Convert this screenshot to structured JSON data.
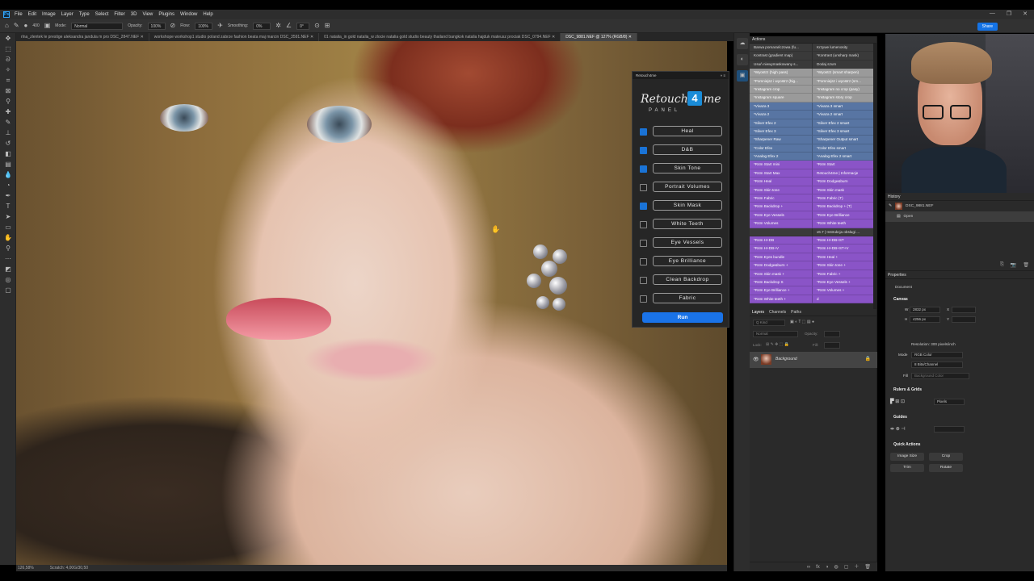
{
  "menubar": {
    "logo": "Ps",
    "items": [
      "File",
      "Edit",
      "Image",
      "Layer",
      "Type",
      "Select",
      "Filter",
      "3D",
      "View",
      "Plugins",
      "Window",
      "Help"
    ],
    "window_controls": [
      "—",
      "❐",
      "✕"
    ]
  },
  "options": {
    "brush_size": "400",
    "mode_label": "Mode:",
    "mode_value": "Normal",
    "opacity_label": "Opacity:",
    "opacity_value": "100%",
    "flow_label": "Flow:",
    "flow_value": "100%",
    "smoothing_label": "Smoothing:",
    "smoothing_value": "0%",
    "angle_value": "0°",
    "share_label": "Share"
  },
  "tabs": [
    {
      "label": "rlna_zlentek le prestige aleksandra jandula m pro DSC_2847.NEF ✕",
      "active": false
    },
    {
      "label": "workshope workshop1 studio poland zabrze fashion beata maj marcin DSC_3591.NEF ✕",
      "active": false
    },
    {
      "label": "01 natalia_in gold natalia_w zlocie natalia gold studio beauty thailand bangkok natalia hajduk mateusz prociak DSC_0794.NEF ✕",
      "active": false
    },
    {
      "label": "DSC_9881.NEF @ 127% (RGB/8) ✕",
      "active": true
    }
  ],
  "status": {
    "zoom": "126,58%",
    "scratch": "Scratch: 4,00G/30,50"
  },
  "retouch_panel": {
    "header": "Retouch4me",
    "header_controls": "»  ≡",
    "logo_left": "Retouch",
    "logo_mid": "4",
    "logo_right": "me",
    "logo_sub": "PANEL",
    "items": [
      {
        "label": "Heal",
        "checked": true
      },
      {
        "label": "D&B",
        "checked": true
      },
      {
        "label": "Skin Tone",
        "checked": true
      },
      {
        "label": "Portrait Volumes",
        "checked": false
      },
      {
        "label": "Skin Mask",
        "checked": true
      },
      {
        "label": "White Teeth",
        "checked": false
      },
      {
        "label": "Eye Vessels",
        "checked": false
      },
      {
        "label": "Eye Brilliance",
        "checked": false
      },
      {
        "label": "Clean Backdrop",
        "checked": false
      },
      {
        "label": "Fabric",
        "checked": false
      }
    ],
    "run_label": "Run"
  },
  "actions_panel": {
    "title": "Actions",
    "rows": [
      {
        "a": "Barwa pomarańczowa (fu...",
        "b": "Krzywe lumenosity",
        "g": "g0"
      },
      {
        "a": "Kontrast (gradient map)",
        "b": "*Kontrast (unsharp mask)",
        "g": "g0"
      },
      {
        "a": "Usuń niewymaskowany s...",
        "b": "Dodaj szum",
        "g": "g0"
      },
      {
        "a": "*Wyostrz (high pass)",
        "b": "*Wyostrz (smart sharpen)",
        "g": "g1"
      },
      {
        "a": "*Pomniejsz i wyostrz (hig...",
        "b": "*Pomniejsz i wyostrz (sm...",
        "g": "g1"
      },
      {
        "a": "*Instagram crop",
        "b": "*Instagram no crop (pasy)",
        "g": "g1"
      },
      {
        "a": "*Instagram square",
        "b": "*Instagram story crop",
        "g": "g1"
      },
      {
        "a": "*Vivaza 3",
        "b": "*Vivaza 3 smart",
        "g": "g2"
      },
      {
        "a": "*Vivaza 2",
        "b": "*Vivaza 2 smart",
        "g": "g2"
      },
      {
        "a": "*Silver Efex 2",
        "b": "*Silver Efex 2 smart",
        "g": "g2"
      },
      {
        "a": "*Silver Efex 3",
        "b": "*Silver Efex 3 smart",
        "g": "g2"
      },
      {
        "a": "*Sharpener Raw",
        "b": "*Sharpener Output smart",
        "g": "g2"
      },
      {
        "a": "*Color Efex",
        "b": "*Color Efex smart",
        "g": "g2"
      },
      {
        "a": "*Analog Efex 2",
        "b": "*Analog Efex 2 smart",
        "g": "g2"
      },
      {
        "a": "*R4m Start mini",
        "b": "*R4m Start",
        "g": "g3"
      },
      {
        "a": "*R4m Start Max",
        "b": "Retouch4me | Informacje",
        "g": "g3"
      },
      {
        "a": "*R4m Heal",
        "b": "*R4m Dodge&burn",
        "g": "g3"
      },
      {
        "a": "*R4m Skin tone",
        "b": "*R4m Skin mask",
        "g": "g3"
      },
      {
        "a": "*R4m Fabric",
        "b": "*R4m Fabric (T)",
        "g": "g3"
      },
      {
        "a": "*R4m Backdrop +",
        "b": "*R4m Backdrop + (T)",
        "g": "g3"
      },
      {
        "a": "*R4m Eye Vessels",
        "b": "*R4m Eye Brilliance",
        "g": "g3"
      },
      {
        "a": "*R4m Volumes",
        "b": "*R4m White teeth",
        "g": "g3"
      },
      {
        "a": "",
        "b": "v6.7 | Instrukcja obsługi ...",
        "g": "g0"
      },
      {
        "a": "*R4m H+DB",
        "b": "*R4m H+DB+ST",
        "g": "g3"
      },
      {
        "a": "*R4m H+DB+V",
        "b": "*R4m H+DB+ST+V",
        "g": "g3"
      },
      {
        "a": "*R4m Eyes bundle",
        "b": "*R4m Heal +",
        "g": "g3"
      },
      {
        "a": "*R4m Dodge&burn +",
        "b": "*R4m Skin tone +",
        "g": "g3"
      },
      {
        "a": "*R4m Skin mask +",
        "b": "*R4m Fabric +",
        "g": "g3"
      },
      {
        "a": "*R4m Backdrop S",
        "b": "*R4m Eye Vessels +",
        "g": "g3"
      },
      {
        "a": "*R4m Eye Brilliance +",
        "b": "*R4m Volumes +",
        "g": "g3"
      },
      {
        "a": "*R4m White teeth +",
        "b": "d",
        "g": "g3"
      }
    ]
  },
  "layers_panel": {
    "tabs": [
      "Layers",
      "Channels",
      "Paths"
    ],
    "kind_placeholder": "Q Kind",
    "blend": "Normal",
    "opacity_label": "Opacity:",
    "lock_label": "Lock:",
    "fill_label": "Fill:",
    "layer_name": "Background",
    "footer_icons": [
      "∞",
      "fx",
      "◑",
      "◍",
      "▢",
      "＋",
      "🗑"
    ]
  },
  "history_panel": {
    "title": "History",
    "doc": "DSC_9881.NEF",
    "step": "Open"
  },
  "properties_panel": {
    "title": "Properties",
    "document_label": "Document",
    "canvas_label": "Canvas",
    "w_label": "W",
    "w_value": "2832 px",
    "h_label": "H",
    "h_value": "4256 px",
    "x_label": "X",
    "y_label": "Y",
    "resolution": "Resolution: 300 pixels/inch",
    "mode_label": "Mode",
    "mode_value": "RGB Color",
    "bits_value": "8 Bits/Channel",
    "fill_label": "Fill",
    "fill_value": "Background Color",
    "rulers_label": "Rulers & Grids",
    "units_value": "Pixels",
    "guides_label": "Guides",
    "quick_actions_label": "Quick Actions",
    "btn_image_size": "Image Size",
    "btn_crop": "Crop",
    "btn_trim": "Trim",
    "btn_rotate": "Rotate"
  }
}
